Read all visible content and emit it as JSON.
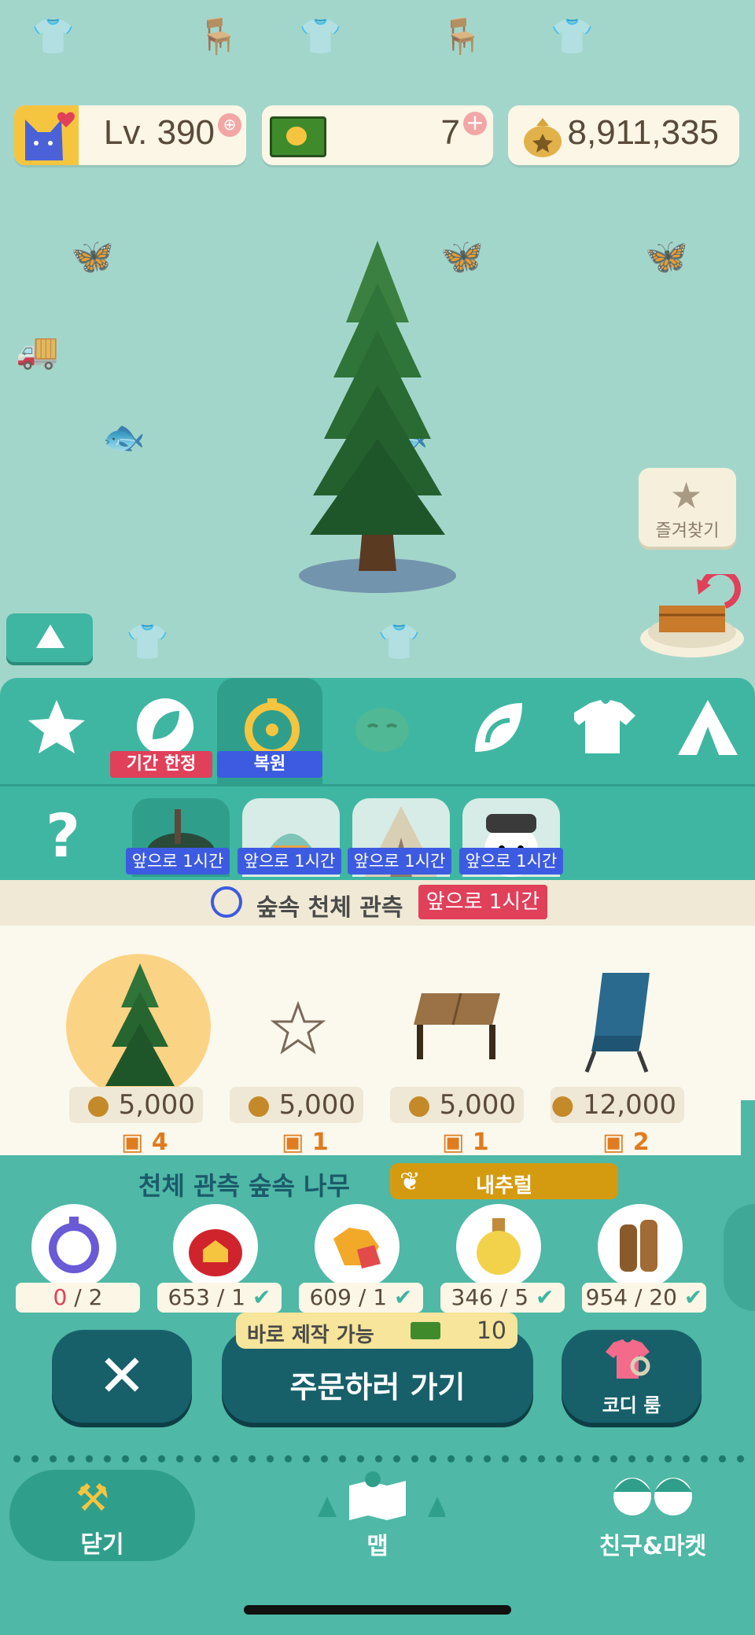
{
  "header": {
    "level_label": "Lv. 390",
    "tickets": "7",
    "bells": "8,911,335"
  },
  "favorites_button": {
    "label": "즐겨찾기"
  },
  "tabs": [
    {
      "icon": "star-icon",
      "tag": ""
    },
    {
      "icon": "limited-leaf-icon",
      "tag": "기간 한정"
    },
    {
      "icon": "restore-clock-icon",
      "tag": "복원"
    },
    {
      "icon": "camel-icon",
      "tag": ""
    },
    {
      "icon": "leaf-icon",
      "tag": ""
    },
    {
      "icon": "shirt-icon",
      "tag": ""
    },
    {
      "icon": "tent-icon",
      "tag": ""
    }
  ],
  "sub_row": {
    "help_glyph": "?",
    "cards": [
      {
        "tag": "앞으로 1시간"
      },
      {
        "tag": "앞으로 1시간"
      },
      {
        "tag": "앞으로 1시간"
      },
      {
        "tag": "앞으로 1시간"
      }
    ]
  },
  "event": {
    "title": "숲속 천체 관측",
    "time_tag": "앞으로 1시간"
  },
  "items": [
    {
      "name": "tree",
      "price": "5,000",
      "count": "4"
    },
    {
      "name": "star-ornament",
      "price": "5,000",
      "count": "1"
    },
    {
      "name": "wooden-table",
      "price": "5,000",
      "count": "1"
    },
    {
      "name": "camp-chair",
      "price": "12,000",
      "count": "2"
    }
  ],
  "selected_item": {
    "name": "천체 관측 숲속 나무",
    "durability_label": "내추럴"
  },
  "materials": [
    {
      "icon": "stopwatch-icon",
      "have": "0",
      "need": "2"
    },
    {
      "icon": "bell-bag-house-icon",
      "have": "653",
      "need": "1"
    },
    {
      "icon": "gem-icon",
      "have": "609",
      "need": "1"
    },
    {
      "icon": "essence-bottle-icon",
      "have": "346",
      "need": "5"
    },
    {
      "icon": "wood-icon",
      "have": "954",
      "need": "20"
    }
  ],
  "craft": {
    "instant_label": "바로 제작 가능",
    "instant_cost": "10",
    "order_button": "주문하러 가기",
    "close_glyph": "✕",
    "codi_room": "코디 룸"
  },
  "nav": {
    "close": "닫기",
    "map": "맵",
    "friends_market": "친구&마켓"
  },
  "colors": {
    "accent_teal": "#3fb6a2",
    "dark_teal": "#17606a",
    "tag_red": "#e0405a",
    "tag_blue": "#3d5be0",
    "gold": "#d49b10"
  }
}
